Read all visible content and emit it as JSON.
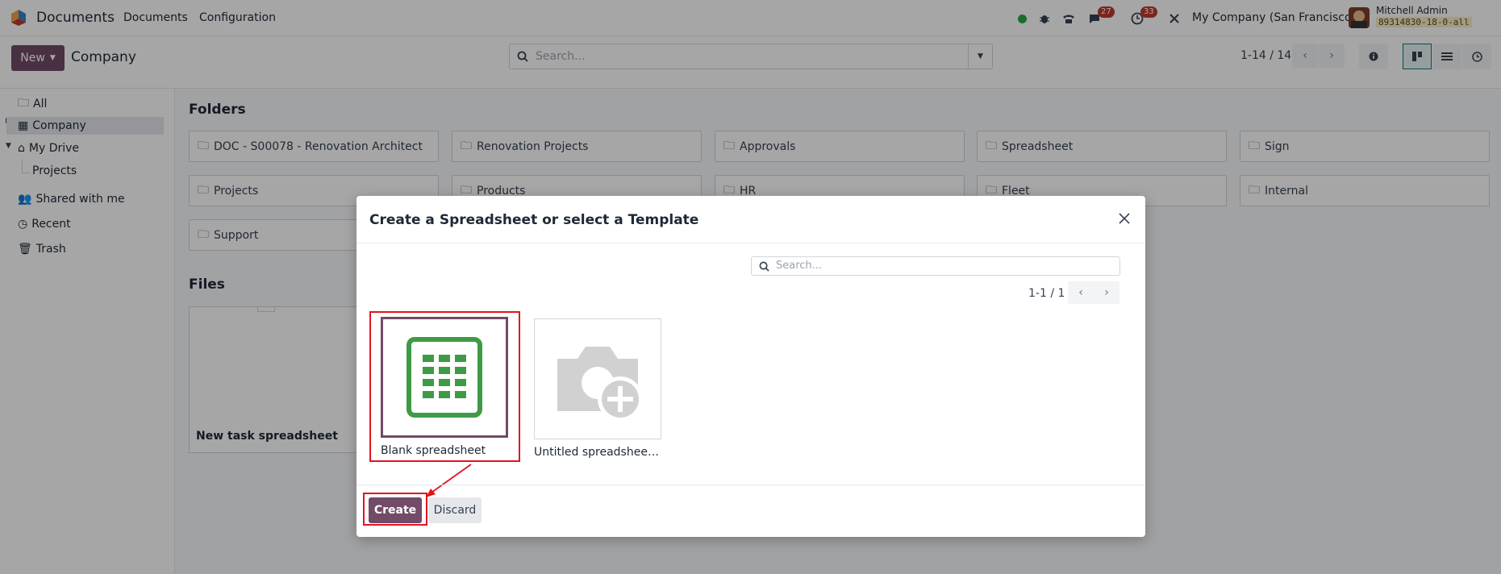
{
  "topbar": {
    "app_name": "Documents",
    "menu": [
      "Documents",
      "Configuration"
    ],
    "activity_badge": "27",
    "clock_badge": "33",
    "company": "My Company (San Francisco)",
    "user_name": "Mitchell Admin",
    "db_name": "89314830-18-0-all"
  },
  "control_panel": {
    "new_label": "New",
    "breadcrumb": "Company",
    "search_placeholder": "Search...",
    "pager": "1-14 / 14"
  },
  "sidebar": {
    "items": [
      "All",
      "Company",
      "My Drive",
      "Projects",
      "Shared with me",
      "Recent",
      "Trash"
    ]
  },
  "main": {
    "folders_title": "Folders",
    "folders": [
      "DOC - S00078 - Renovation Architect",
      "Renovation Projects",
      "Approvals",
      "Spreadsheet",
      "Sign",
      "Projects",
      "Products",
      "HR",
      "Fleet",
      "Internal",
      "Support"
    ],
    "files_title": "Files",
    "files": [
      "New task spreadsheet"
    ]
  },
  "modal": {
    "title": "Create a Spreadsheet or select a Template",
    "search_placeholder": "Search...",
    "pager": "1-1 / 1",
    "templates": [
      "Blank spreadsheet",
      "Untitled spreadsheet - ..."
    ],
    "create_label": "Create",
    "discard_label": "Discard"
  },
  "colors": {
    "brand": "#714b67",
    "annotation": "#e3131d",
    "sheet_green": "#3e9b45"
  },
  "icons": [
    "app-logo-icon",
    "status-dot-icon",
    "bug-icon",
    "phone-icon",
    "chat-icon",
    "clock-icon",
    "tools-icon",
    "search-icon",
    "caret-down-icon",
    "chevron-left-icon",
    "chevron-right-icon",
    "info-icon",
    "kanban-icon",
    "list-icon",
    "activity-icon",
    "folder-icon",
    "building-icon",
    "drive-icon",
    "users-icon",
    "history-icon",
    "trash-icon",
    "close-icon",
    "spreadsheet-icon",
    "add-photo-icon"
  ]
}
